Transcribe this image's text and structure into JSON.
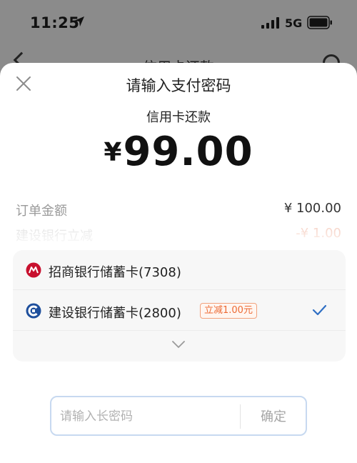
{
  "status_bar": {
    "time": "11:25",
    "network": "5G",
    "icons": [
      "location-arrow-icon",
      "signal-icon",
      "battery-icon"
    ]
  },
  "background_page": {
    "title": "信用卡还款"
  },
  "sheet": {
    "title": "请输入支付密码",
    "subject": "信用卡还款",
    "currency": "¥",
    "amount": "99.00",
    "order_label": "订单金额",
    "order_value": "¥ 100.00",
    "discount_label": "建设银行立减",
    "discount_value": "-¥ 1.00"
  },
  "cards": [
    {
      "name": "招商银行储蓄卡(7308)",
      "logo": "cmb-logo-icon",
      "selected": false,
      "badge": ""
    },
    {
      "name": "建设银行储蓄卡(2800)",
      "logo": "ccb-logo-icon",
      "selected": true,
      "badge": "立减1.00元"
    }
  ],
  "password": {
    "placeholder": "请输入长密码",
    "value": "",
    "confirm_label": "确定"
  },
  "colors": {
    "accent_blue": "#2f6fc4",
    "promo_orange": "#ec6a34",
    "cmb_red": "#c8102e",
    "ccb_blue": "#1e4f9c",
    "overlay_gray": "#8b8b8b"
  }
}
